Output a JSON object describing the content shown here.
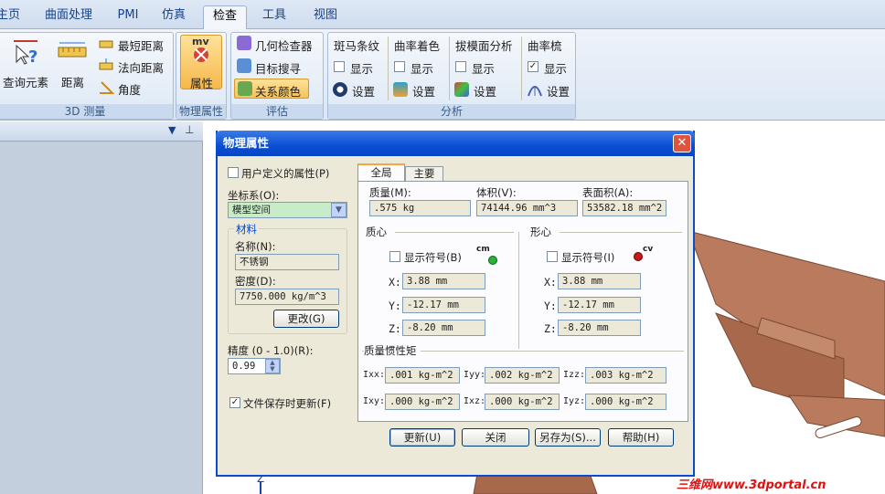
{
  "tabs": [
    "主页",
    "曲面处理",
    "PMI",
    "仿真",
    "检查",
    "工具",
    "视图"
  ],
  "active_tab": "检查",
  "ribbon": {
    "measure": {
      "query_label": "查询元素",
      "distance_label": "距离",
      "min_distance": "最短距离",
      "normal_distance": "法向距离",
      "angle": "角度",
      "title": "3D 测量"
    },
    "physical": {
      "props_label": "属性",
      "icon_text": "mv",
      "title": "物理属性"
    },
    "evaluate": {
      "geometry_inspector": "几何检查器",
      "target_search": "目标搜寻",
      "relation_color": "关系颜色",
      "title": "评估"
    },
    "analysis": {
      "title": "分析",
      "columns": [
        {
          "title": "斑马条纹",
          "show": "显示",
          "setting": "设置",
          "checked": false
        },
        {
          "title": "曲率着色",
          "show": "显示",
          "setting": "设置",
          "checked": false
        },
        {
          "title": "拔模面分析",
          "show": "显示",
          "setting": "设置",
          "checked": false
        },
        {
          "title": "曲率梳",
          "show": "显示",
          "setting": "设置",
          "checked": true
        }
      ]
    }
  },
  "dialog": {
    "title": "物理属性",
    "close": "✕",
    "user_defined": "用户定义的属性(P)",
    "coord_label": "坐标系(O):",
    "coord_value": "模型空间",
    "material_group": "材料",
    "name_label": "名称(N):",
    "name_value": "不锈钢",
    "density_label": "密度(D):",
    "density_value": "7750.000 kg/m^3",
    "change_btn": "更改(G)",
    "precision_label": "精度 (0 - 1.0)(R):",
    "precision_value": "0.99",
    "update_on_save": "文件保存时更新(F)",
    "tabs": [
      "全局",
      "主要"
    ],
    "mass_label": "质量(M):",
    "mass_value": ".575 kg",
    "volume_label": "体积(V):",
    "volume_value": "74144.96 mm^3",
    "area_label": "表面积(A):",
    "area_value": "53582.18 mm^2",
    "cg_title": "质心",
    "cg_show": "显示符号(B)",
    "cg_symbol": "cm",
    "cv_title": "形心",
    "cv_show": "显示符号(I)",
    "cv_symbol": "cv",
    "x_label": "X:",
    "y_label": "Y:",
    "z_label": "Z:",
    "cg": {
      "x": "3.88 mm",
      "y": "-12.17 mm",
      "z": "-8.20 mm"
    },
    "cv": {
      "x": "3.88 mm",
      "y": "-12.17 mm",
      "z": "-8.20 mm"
    },
    "inertia_title": "质量惯性矩",
    "inertia": [
      {
        "label": "Ixx:",
        "value": ".001 kg-m^2"
      },
      {
        "label": "Iyy:",
        "value": ".002 kg-m^2"
      },
      {
        "label": "Izz:",
        "value": ".003 kg-m^2"
      },
      {
        "label": "Ixy:",
        "value": ".000 kg-m^2"
      },
      {
        "label": "Ixz:",
        "value": ".000 kg-m^2"
      },
      {
        "label": "Iyz:",
        "value": ".000 kg-m^2"
      }
    ],
    "buttons": [
      "更新(U)",
      "关闭",
      "另存为(S)...",
      "帮助(H)"
    ]
  },
  "viewport": {
    "axis_label": "Z"
  },
  "watermark": "三维网www.3dportal.cn",
  "colors": {
    "part": "#b97a5e",
    "accent": "#0a4ed3",
    "watermark": "#e01010"
  }
}
